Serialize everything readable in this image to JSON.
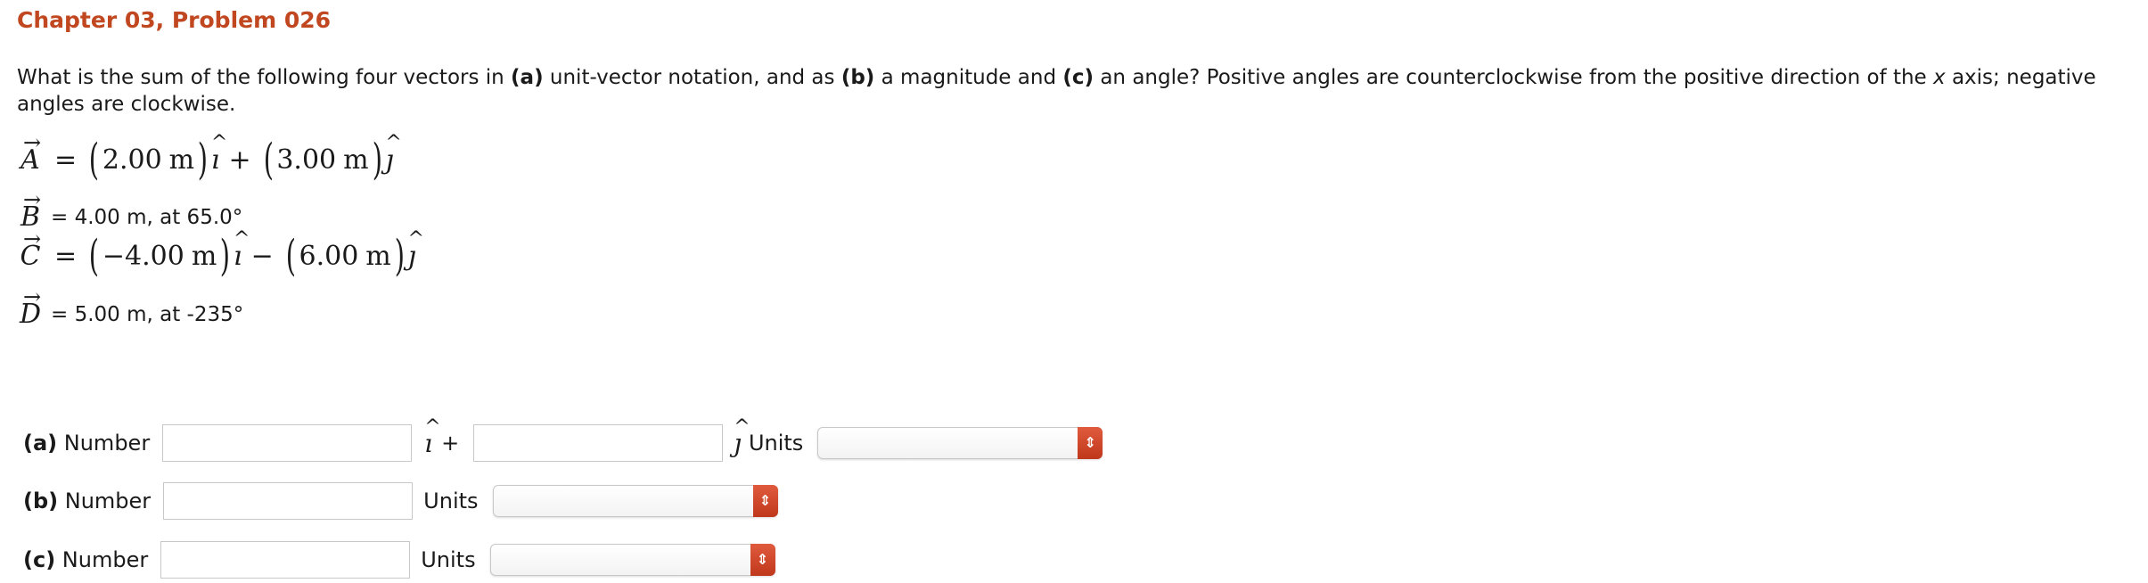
{
  "header": {
    "title": "Chapter 03, Problem 026"
  },
  "question": {
    "intro": "What is the sum of the following four vectors in ",
    "part_a_tag": "(a)",
    "part_a_text": " unit-vector notation, and as ",
    "part_b_tag": "(b)",
    "part_b_text": " a magnitude and ",
    "part_c_tag": "(c)",
    "part_c_text": " an angle? Positive angles are counterclockwise from the positive direction of the ",
    "axis_var": "x",
    "tail": " axis; negative angles are clockwise."
  },
  "vectors": {
    "A": {
      "symbol": "A",
      "arrow": "→",
      "equals": "=",
      "x_value": "2.00",
      "x_unit": "m",
      "i_hat": "ı",
      "hat": "^",
      "op": "+",
      "y_value": "3.00",
      "y_unit": "m",
      "j_hat": "ȷ"
    },
    "B": {
      "symbol": "B",
      "arrow": "→",
      "text": "= 4.00 m, at 65.0°"
    },
    "C": {
      "symbol": "C",
      "arrow": "→",
      "equals": "=",
      "x_value": "−4.00",
      "x_unit": "m",
      "i_hat": "ı",
      "hat": "^",
      "op": "−",
      "y_value": "6.00",
      "y_unit": "m",
      "j_hat": "ȷ"
    },
    "D": {
      "symbol": "D",
      "arrow": "→",
      "text": "= 5.00 m, at -235°"
    }
  },
  "answers": {
    "a": {
      "tag": "(a)",
      "label": " Number",
      "i_hat": "ı",
      "hat": "^",
      "plus": "+",
      "j_hat": "ȷ",
      "units_label": "Units",
      "value_x": "",
      "value_y": "",
      "units_selected": ""
    },
    "b": {
      "tag": "(b)",
      "label": " Number",
      "units_label": "Units",
      "value": "",
      "units_selected": ""
    },
    "c": {
      "tag": "(c)",
      "label": " Number",
      "units_label": "Units",
      "value": "",
      "units_selected": ""
    },
    "select_arrow": "⇕"
  },
  "colors": {
    "title": "#c0471f",
    "select_button": "#c0381b"
  }
}
